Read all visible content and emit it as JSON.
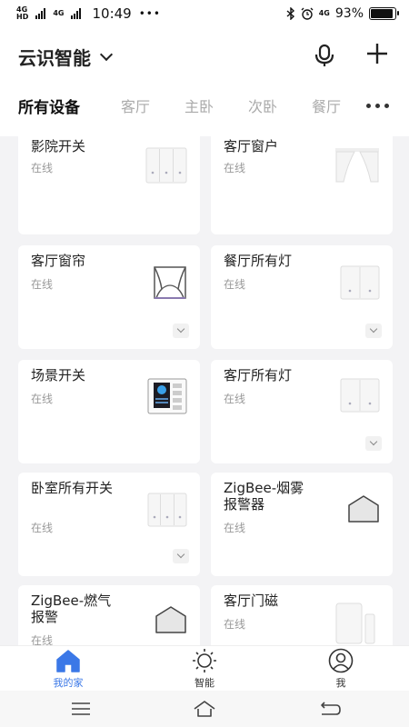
{
  "status_bar": {
    "sim1": "4G",
    "sim1_sup": "HD",
    "sim2": "4G",
    "time": "10:49",
    "dots": "•••",
    "bluetooth_icon": "bluetooth-icon",
    "alarm_icon": "alarm-icon",
    "net": "4G",
    "battery_percent": "93%",
    "battery_level": 0.93
  },
  "header": {
    "home_name": "云识智能",
    "mic_icon": "microphone-icon",
    "add_icon": "plus-icon"
  },
  "tabs": [
    {
      "label": "所有设备",
      "active": true
    },
    {
      "label": "客厅",
      "active": false
    },
    {
      "label": "主卧",
      "active": false
    },
    {
      "label": "次卧",
      "active": false
    },
    {
      "label": "餐厅",
      "active": false
    }
  ],
  "devices": [
    {
      "name": "影院开关",
      "status": "在线",
      "icon": "triple-switch-icon",
      "expand": false
    },
    {
      "name": "客厅窗户",
      "status": "在线",
      "icon": "window-icon",
      "expand": false
    },
    {
      "name": "客厅窗帘",
      "status": "在线",
      "icon": "curtain-icon",
      "expand": true
    },
    {
      "name": "餐厅所有灯",
      "status": "在线",
      "icon": "double-switch-icon",
      "expand": true
    },
    {
      "name": "场景开关",
      "status": "在线",
      "icon": "scene-panel-icon",
      "expand": false
    },
    {
      "name": "客厅所有灯",
      "status": "在线",
      "icon": "double-switch-icon",
      "expand": true
    },
    {
      "name": "卧室所有开关",
      "status": "在线",
      "icon": "triple-switch-icon",
      "expand": true
    },
    {
      "name": "ZigBee-烟雾报警器",
      "status": "在线",
      "icon": "alarm-house-icon",
      "expand": false
    },
    {
      "name": "ZigBee-燃气报警",
      "status": "在线",
      "icon": "alarm-house-icon",
      "expand": false
    },
    {
      "name": "客厅门磁",
      "status": "在线",
      "icon": "door-sensor-icon",
      "expand": false
    }
  ],
  "bottom_nav": [
    {
      "label": "我的家",
      "icon": "home-icon",
      "active": true
    },
    {
      "label": "智能",
      "icon": "sun-icon",
      "active": false
    },
    {
      "label": "我",
      "icon": "user-icon",
      "active": false
    }
  ],
  "system_nav": {
    "menu_icon": "menu-icon",
    "home_icon": "home-outline-icon",
    "back_icon": "back-icon"
  },
  "colors": {
    "accent": "#3b78e7",
    "background": "#f3f3f5"
  }
}
